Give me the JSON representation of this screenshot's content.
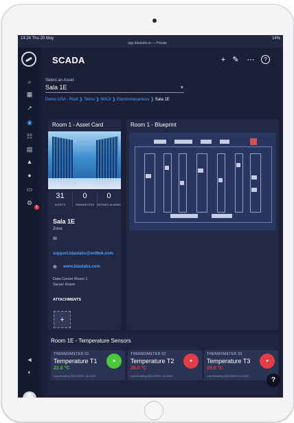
{
  "status_bar": {
    "time": "14:24",
    "date": "Thu 20 May",
    "url": "app.blaulabs.io — Private",
    "battery": "14%"
  },
  "header": {
    "title": "SCADA",
    "add_icon": "plus-icon",
    "edit_icon": "edit-icon",
    "more_icon": "more-icon",
    "help_icon": "help-icon"
  },
  "sidebar": {
    "icons": [
      "search-icon",
      "grid-icon",
      "chart-icon",
      "dashboard-icon",
      "hierarchy-icon",
      "document-icon",
      "bell-icon",
      "user-icon",
      "display-icon",
      "gear-icon"
    ],
    "notification_count": "1",
    "bottom_icons": [
      "megaphone-icon",
      "contrast-icon",
      "avatar"
    ]
  },
  "asset_select": {
    "label": "Select an Asset",
    "value": "Sala 1E"
  },
  "breadcrumb": {
    "items": [
      "Demo USA - Root",
      "Tekno",
      "MSOI",
      "Electromecanicos"
    ],
    "current": "Sala 1E"
  },
  "asset_card": {
    "title": "Room 1 - Asset Card",
    "stats": [
      {
        "value": "31",
        "label": "ASSETS"
      },
      {
        "value": "0",
        "label": "PARAMETERS"
      },
      {
        "value": "0",
        "label": "DEFINED ALARMS"
      }
    ],
    "name": "Sala 1E",
    "type": "Zone",
    "email": "support.blaulabs@softtek.com",
    "website": "www.blaulabs.com",
    "description": "Data Center Room 1",
    "category": "Server Room",
    "attachments_label": "ATTACHMENTS",
    "add_label": "+"
  },
  "blueprint": {
    "title": "Room 1 - Blueprint"
  },
  "sensors": {
    "title": "Room 1E - Temperature Sensors",
    "items": [
      {
        "header": "THERMOMETER 01",
        "name": "Temperature T1",
        "value": "21.0 °C",
        "status": "ok",
        "last_reading": "Last Reading 2021/05/20 14:23:01"
      },
      {
        "header": "THERMOMETER 02",
        "name": "Temperature T2",
        "value": "28.0 °C",
        "status": "alarm",
        "last_reading": "Last Reading 2021/05/20 14:23:01"
      },
      {
        "header": "THERMOMETER 03",
        "name": "Temperature T3",
        "value": "29.0 °C",
        "status": "alarm",
        "last_reading": "Last Reading 2021/05/20 14:23:01"
      }
    ]
  },
  "help_button": "?",
  "colors": {
    "background": "#1b2038",
    "card": "#232944",
    "accent": "#39a4ff",
    "link": "#4aa6ff",
    "ok": "#4cc63b",
    "alarm": "#e23c44"
  }
}
